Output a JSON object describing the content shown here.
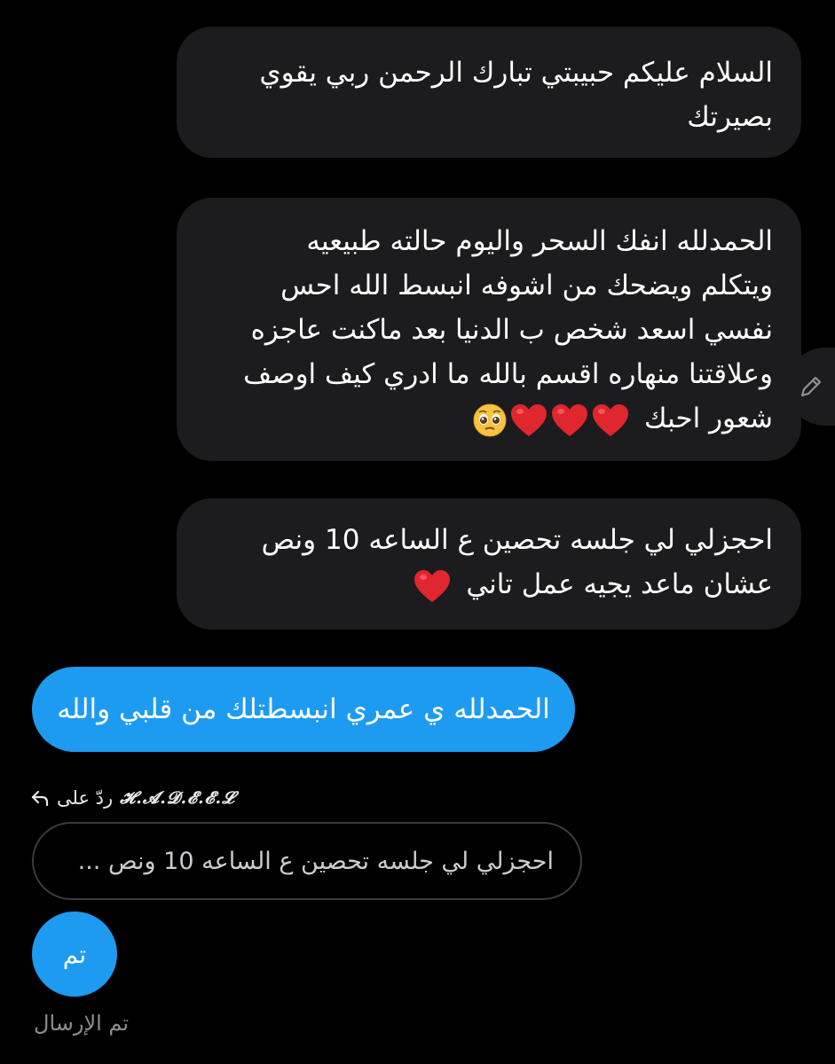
{
  "messages": {
    "m1": "السلام عليكم حبيبتي تبارك الرحمن ربي يقوي\nبصيرتك",
    "m2": "الحمدلله انفك السحر واليوم حالته طبيعيه\nويتكلم ويضحك من اشوفه انبسط الله احس\nنفسي اسعد شخص ب الدنيا بعد ماكنت عاجزه\nوعلاقتنا منهاره اقسم بالله ما ادري كيف اوصف\nشعور احبك",
    "m3": "احجزلي لي جلسه تحصين ع الساعه 10 ونص\nعشان ماعد يجيه عمل تاني",
    "sent": "الحمدلله ي عمري انبسطتلك من قلبي والله"
  },
  "reply": {
    "prefix": "ردّ على",
    "name": "𝓗.𝓐.𝓓.𝓔.𝓔.𝓛",
    "quote": "احجزلي لي جلسه تحصين ع الساعه 10 ونص ..."
  },
  "last_message": "تم",
  "status_text": "تم الإرسال",
  "icons": {
    "edit": "pencil-icon",
    "reply": "reply-arrow-icon",
    "heart": "red-heart-icon",
    "pleading": "pleading-face-icon"
  },
  "colors": {
    "background": "#000000",
    "incoming_bubble": "#1c1c1e",
    "outgoing_bubble": "#1d9bf0",
    "heart": "#e0262f"
  }
}
